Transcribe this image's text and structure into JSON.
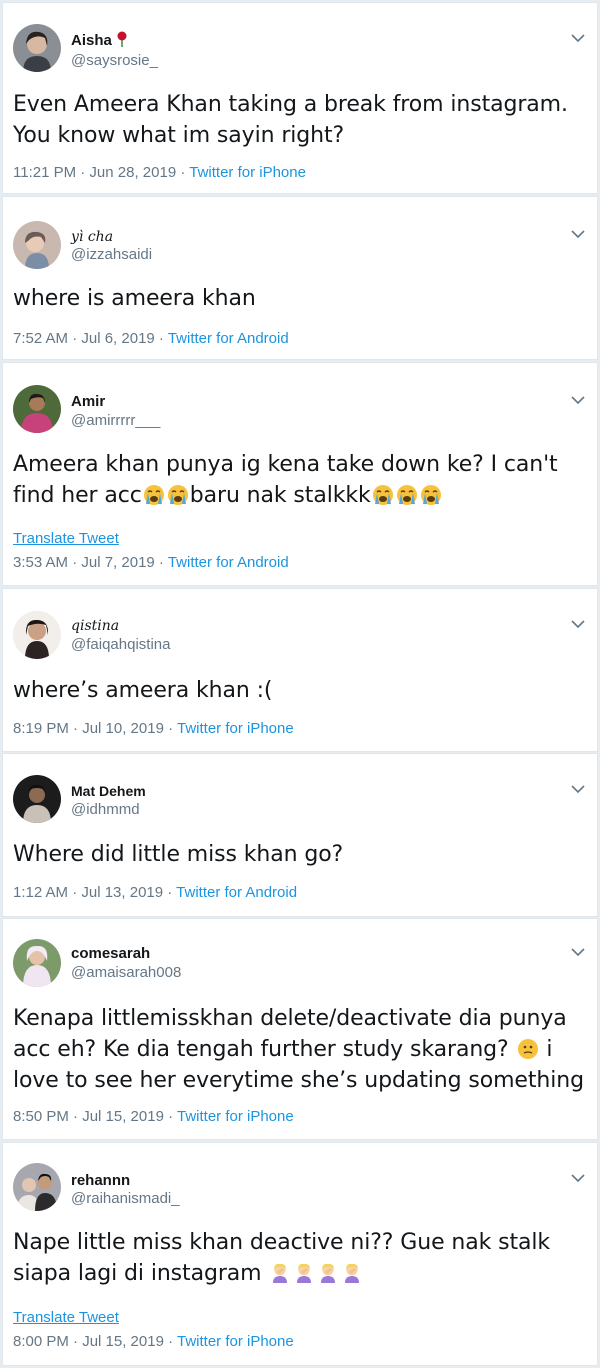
{
  "tweets": [
    {
      "name": "Aisha",
      "handle": "@saysrosie_",
      "text": "Even Ameera Khan taking a break from instagram. You know what im sayin right?",
      "time": "11:21 PM · Jun 28, 2019 · ",
      "source": "Twitter for iPhone",
      "avatar_color": "#8a8f96",
      "icons": [
        "rose-icon",
        "chevron-down-icon"
      ]
    },
    {
      "name": "yì cha",
      "handle": "@izzahsaidi",
      "text": "where is ameera khan",
      "time": "7:52 AM · Jul 6, 2019 · ",
      "source": "Twitter for Android",
      "avatar_color": "#c9b8b0"
    },
    {
      "name": "Amir",
      "handle": "@amirrrrr___",
      "text_parts": [
        "Ameera khan punya ig kena take down ke? I can't find her acc",
        "baru nak stalkkk"
      ],
      "emoji": "loudly-crying-face-icon",
      "translate": "Translate Tweet",
      "time": "3:53 AM · Jul 7, 2019 · ",
      "source": "Twitter for Android",
      "avatar_color": "#b8443d"
    },
    {
      "name": "qistina",
      "handle": "@faiqahqistina",
      "text": "where’s ameera khan :(",
      "time": "8:19 PM · Jul 10, 2019 · ",
      "source": "Twitter for iPhone",
      "avatar_color": "#3a2d2a"
    },
    {
      "name": "Mat Dehem",
      "handle": "@idhmmd",
      "text": "Where did little miss khan go?",
      "time": "1:12 AM · Jul 13, 2019 · ",
      "source": "Twitter for Android",
      "avatar_color": "#1c1c1c"
    },
    {
      "name": "comesarah",
      "handle": "@amaisarah008",
      "text_parts": [
        "Kenapa littlemisskhan delete/deactivate dia punya acc eh? Ke dia tengah further study skarang? ",
        " i love to see her everytime she’s updating something"
      ],
      "emoji": "confused-face-icon",
      "time": "8:50 PM · Jul 15, 2019 · ",
      "source": "Twitter for iPhone",
      "avatar_color": "#7d9a6a"
    },
    {
      "name": "rehannn",
      "handle": "@raihanismadi_",
      "text": "Nape little miss khan deactive ni?? Gue nak stalk siapa lagi di instagram ",
      "emoji": "woman-facepalming-icon",
      "translate": "Translate Tweet",
      "time": "8:00 PM · Jul 15, 2019 · ",
      "source": "Twitter for iPhone",
      "avatar_color": "#a7a7b0"
    }
  ],
  "colors": {
    "link": "#1b95e0",
    "secondary": "#657786",
    "border": "#e1e8ed"
  }
}
